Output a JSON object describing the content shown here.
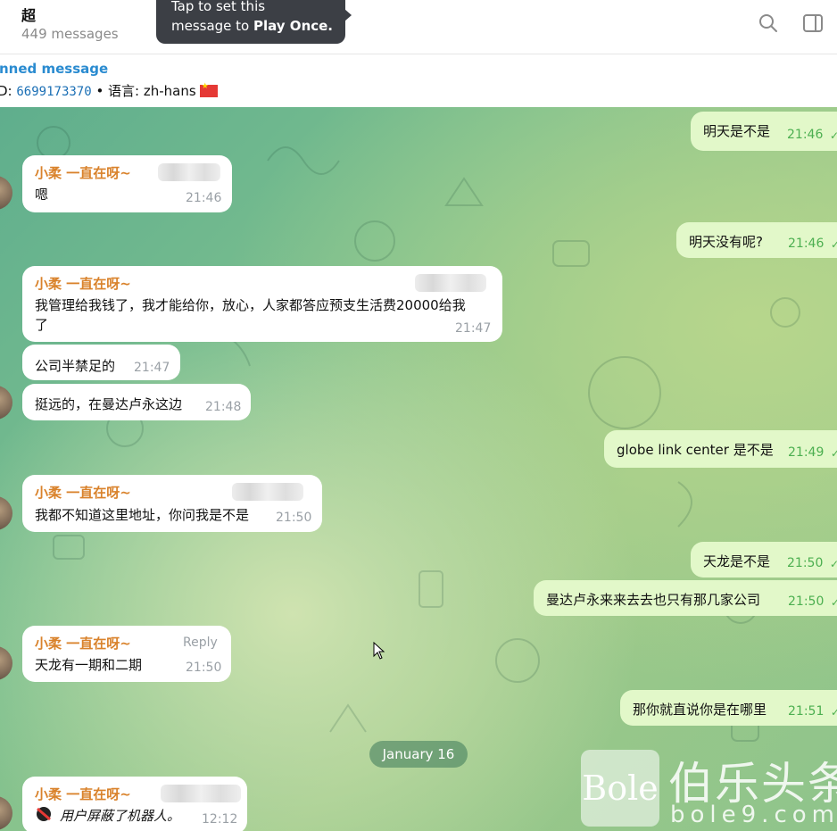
{
  "header": {
    "title": "超",
    "subtitle": "449 messages",
    "tooltip_line1": "Tap to set this",
    "tooltip_line2_prefix": "message to ",
    "tooltip_line2_bold": "Play Once."
  },
  "pinned": {
    "title": "nned message",
    "id_prefix": "D: ",
    "id_value": "6699173370",
    "lang": " • 语言: zh-hans"
  },
  "messages": [
    {
      "dir": "out",
      "text": "明天是不是",
      "time": "21:46"
    },
    {
      "dir": "in",
      "sender": "小柔 一直在呀~",
      "text": "嗯",
      "time": "21:46"
    },
    {
      "dir": "out",
      "text": "明天没有呢?",
      "time": "21:46"
    },
    {
      "dir": "in",
      "sender": "小柔 一直在呀~",
      "text": "我管理给我钱了，我才能给你，放心，人家都答应预支生活费20000给我",
      "text2": "了",
      "time": "21:47"
    },
    {
      "dir": "in",
      "text": "公司半禁足的",
      "time": "21:47"
    },
    {
      "dir": "in",
      "text": "挺远的，在曼达卢永这边",
      "time": "21:48"
    },
    {
      "dir": "out",
      "text": "globe link center 是不是",
      "time": "21:49"
    },
    {
      "dir": "in",
      "sender": "小柔 一直在呀~",
      "text": "我都不知道这里地址，你问我是不是",
      "time": "21:50"
    },
    {
      "dir": "out",
      "text": "天龙是不是",
      "time": "21:50"
    },
    {
      "dir": "out",
      "text": "曼达卢永来来去去也只有那几家公司",
      "time": "21:50"
    },
    {
      "dir": "in",
      "sender": "小柔 一直在呀~",
      "reply": "Reply",
      "text": "天龙有一期和二期",
      "time": "21:50"
    },
    {
      "dir": "out",
      "text": "那你就直说你是在哪里",
      "time": "21:51"
    },
    {
      "dir": "in",
      "sender": "小柔 一直在呀~",
      "text": "用户屏蔽了机器人。",
      "time": "12:12"
    }
  ],
  "date_separator": "January 16",
  "watermark": {
    "box": "Bole",
    "cn": "伯乐头条",
    "url": "bole9.com"
  },
  "icons": [
    "search-icon",
    "sidebar-toggle-icon",
    "checkmark-icon",
    "cursor-icon",
    "flag-icon",
    "blocked-icon"
  ]
}
